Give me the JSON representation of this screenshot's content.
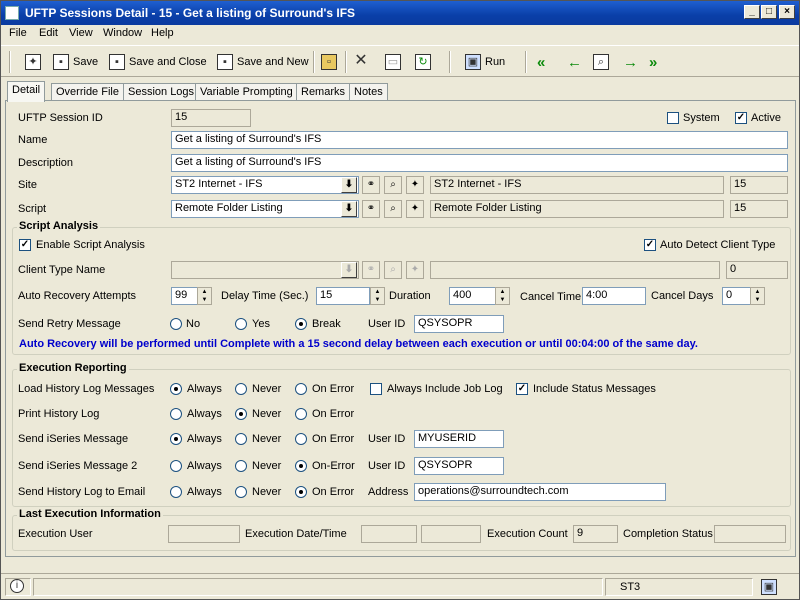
{
  "window": {
    "title": "UFTP Sessions Detail - 15 - Get a listing of Surround's IFS"
  },
  "menu": [
    "File",
    "Edit",
    "View",
    "Window",
    "Help"
  ],
  "toolbar": {
    "save": "Save",
    "save_close": "Save and Close",
    "save_new": "Save and New",
    "run": "Run"
  },
  "tabs": [
    "Detail",
    "Override File",
    "Session Logs",
    "Variable Prompting",
    "Remarks",
    "Notes"
  ],
  "detail": {
    "session_id_label": "UFTP Session ID",
    "session_id": "15",
    "system_label": "System",
    "system_checked": false,
    "active_label": "Active",
    "active_checked": true,
    "name_label": "Name",
    "name": "Get a listing of Surround's IFS",
    "description_label": "Description",
    "description": "Get a listing of Surround's IFS",
    "site_label": "Site",
    "site": "ST2 Internet - IFS",
    "site_desc": "ST2 Internet - IFS",
    "site_num": "15",
    "script_label": "Script",
    "script": "Remote Folder Listing",
    "script_desc": "Remote Folder Listing",
    "script_num": "15"
  },
  "script_analysis": {
    "title": "Script Analysis",
    "enable_label": "Enable Script Analysis",
    "enable_checked": true,
    "auto_detect_label": "Auto Detect Client Type",
    "auto_detect_checked": true,
    "client_type_label": "Client Type Name",
    "client_type": "",
    "client_desc": "",
    "client_num": "0",
    "recovery_label": "Auto Recovery Attempts",
    "recovery": "99",
    "delay_label": "Delay Time (Sec.)",
    "delay": "15",
    "duration_label": "Duration",
    "duration": "400",
    "cancel_time_label": "Cancel Time",
    "cancel_time": "4:00",
    "cancel_days_label": "Cancel Days",
    "cancel_days": "0",
    "retry_label": "Send Retry Message",
    "retry_options": [
      "No",
      "Yes",
      "Break"
    ],
    "retry_selected": "Break",
    "user_id_label": "User ID",
    "user_id": "QSYSOPR",
    "message": "Auto Recovery will be performed until Complete with a 15 second delay between each execution or until 00:04:00 of the same day."
  },
  "execution_reporting": {
    "title": "Execution Reporting",
    "always": "Always",
    "never": "Never",
    "on_error": "On Error",
    "on_error_dash": "On-Error",
    "load_label": "Load History Log Messages",
    "load_selected": "Always",
    "include_job_label": "Always Include Job Log",
    "include_job_checked": false,
    "include_status_label": "Include Status Messages",
    "include_status_checked": true,
    "print_label": "Print History Log",
    "print_selected": "Never",
    "iseries_label": "Send iSeries Message",
    "iseries_selected": "Always",
    "iseries_user_label": "User ID",
    "iseries_user": "MYUSERID",
    "iseries2_label": "Send iSeries Message 2",
    "iseries2_selected": "On-Error",
    "iseries2_user_label": "User ID",
    "iseries2_user": "QSYSOPR",
    "email_label": "Send History Log to Email",
    "email_selected": "On Error",
    "address_label": "Address",
    "address": "operations@surroundtech.com"
  },
  "last_execution": {
    "title": "Last Execution Information",
    "user_label": "Execution User",
    "user": "",
    "datetime_label": "Execution Date/Time",
    "date": "",
    "time": "",
    "count_label": "Execution Count",
    "count": "9",
    "completion_label": "Completion Status",
    "completion": ""
  },
  "status": {
    "system": "ST3"
  }
}
